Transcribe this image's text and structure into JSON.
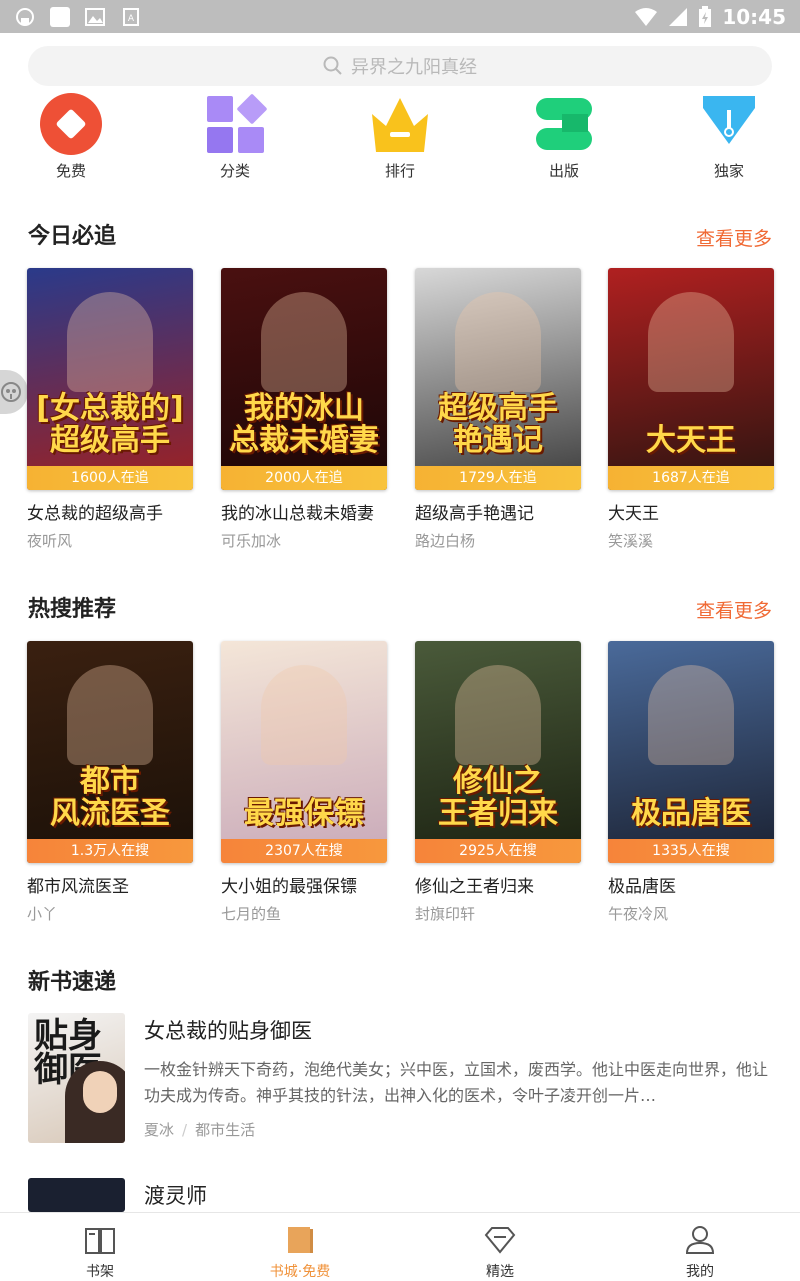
{
  "status_bar": {
    "time": "10:45"
  },
  "search": {
    "placeholder": "异界之九阳真经"
  },
  "categories": [
    {
      "label": "免费",
      "icon": "free-icon"
    },
    {
      "label": "分类",
      "icon": "category-icon"
    },
    {
      "label": "排行",
      "icon": "ranking-crown-icon"
    },
    {
      "label": "出版",
      "icon": "publish-icon"
    },
    {
      "label": "独家",
      "icon": "exclusive-pen-icon"
    }
  ],
  "today": {
    "title": "今日必追",
    "more": "查看更多",
    "books": [
      {
        "name": "女总裁的超级高手",
        "author": "夜听风",
        "count": "1600人在追",
        "cover_text": "[女总裁的]\n超级高手",
        "bg": [
          "#2a3a8a",
          "#a02020"
        ]
      },
      {
        "name": "我的冰山总裁未婚妻",
        "author": "可乐加冰",
        "count": "2000人在追",
        "cover_text": "我的冰山\n总裁未婚妻",
        "bg": [
          "#4a1010",
          "#1a0606"
        ]
      },
      {
        "name": "超级高手艳遇记",
        "author": "路边白杨",
        "count": "1729人在追",
        "cover_text": "超级高手\n艳遇记",
        "bg": [
          "#d8d8d8",
          "#3a3a3a"
        ]
      },
      {
        "name": "大天王",
        "author": "笑溪溪",
        "count": "1687人在追",
        "cover_text": "大天王",
        "bg": [
          "#b02020",
          "#2a1410"
        ]
      }
    ]
  },
  "hot": {
    "title": "热搜推荐",
    "more": "查看更多",
    "books": [
      {
        "name": "都市风流医圣",
        "author": "小丫",
        "count": "1.3万人在搜",
        "cover_text": "都市\n风流医圣",
        "bg": [
          "#3a2010",
          "#1a1008"
        ]
      },
      {
        "name": "大小姐的最强保镖",
        "author": "七月的鱼",
        "count": "2307人在搜",
        "cover_text": "最强保镖",
        "bg": [
          "#f4e6d8",
          "#c8a8b8"
        ]
      },
      {
        "name": "修仙之王者归来",
        "author": "封旗印轩",
        "count": "2925人在搜",
        "cover_text": "修仙之\n王者归来",
        "bg": [
          "#4a5a3a",
          "#1a2010"
        ]
      },
      {
        "name": "极品唐医",
        "author": "午夜冷风",
        "count": "1335人在搜",
        "cover_text": "极品唐医",
        "bg": [
          "#4a6a9a",
          "#1a2030"
        ]
      }
    ]
  },
  "newbooks": {
    "title": "新书速递",
    "items": [
      {
        "title": "女总裁的贴身御医",
        "desc": "一枚金针辨天下奇药，泡绝代美女；兴中医，立国术，废西学。他让中医走向世界，他让功夫成为传奇。神乎其技的针法，出神入化的医术，令叶子凌开创一片…",
        "author": "夏冰",
        "genre": "都市生活",
        "cover_text": "贴身\n御医"
      },
      {
        "title": "渡灵师"
      }
    ]
  },
  "tabbar": [
    {
      "label": "书架",
      "icon": "bookshelf-icon"
    },
    {
      "label": "书城·免费",
      "icon": "bookstore-icon"
    },
    {
      "label": "精选",
      "icon": "diamond-icon"
    },
    {
      "label": "我的",
      "icon": "profile-icon"
    }
  ],
  "colors": {
    "accent": "#f06a35",
    "active_tab": "#f0923a",
    "band_yellow": "#f7bb38",
    "band_orange": "#f78a3b"
  }
}
